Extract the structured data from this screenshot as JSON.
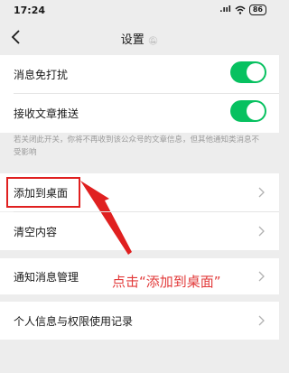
{
  "status_bar": {
    "time": "17:24",
    "signal": ".ııl",
    "battery": "86"
  },
  "nav": {
    "title": "设置"
  },
  "settings": {
    "mute_notifications": {
      "label": "消息免打扰",
      "on": true
    },
    "receive_articles": {
      "label": "接收文章推送",
      "on": true
    },
    "hint": "若关闭此开关，你将不再收到该公众号的文章信息，但其他通知类消息不受影响",
    "add_to_desktop": "添加到桌面",
    "clear_content": "清空内容",
    "notification_management": "通知消息管理",
    "privacy_records": "个人信息与权限使用记录"
  },
  "annotation": {
    "text": "点击“添加到桌面”",
    "color": "#e23a3a"
  },
  "colors": {
    "toggle_on": "#07c160",
    "background": "#ededed",
    "annotation_red": "#e02020"
  }
}
